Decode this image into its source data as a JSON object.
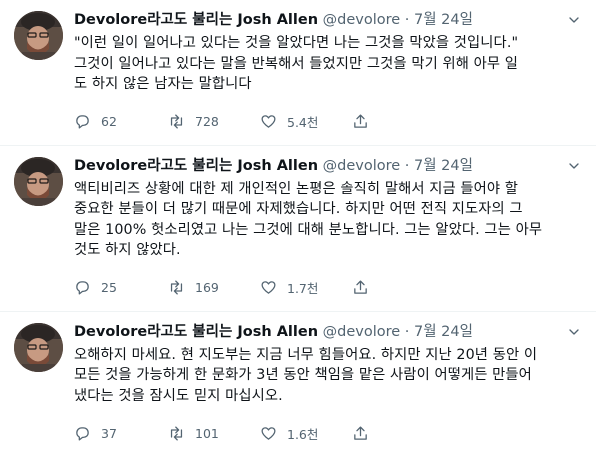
{
  "colors": {
    "text": "#0f1419",
    "secondary": "#536471",
    "divider": "#eff3f4"
  },
  "tweets": [
    {
      "display_name": "Devolore라고도 불리는 Josh Allen",
      "handle": "@devolore",
      "separator": "·",
      "date": "7월 24일",
      "text": "\"이런 일이 일어나고 있다는 것을 알았다면 나는 그것을 막았을 것입니다.\"\n그것이 일어나고 있다는 말을 반복해서 들었지만 그것을 막기 위해 아무 일\n도 하지 않은 남자는 말합니다",
      "replies": "62",
      "retweets": "728",
      "likes": "5.4천"
    },
    {
      "display_name": "Devolore라고도 불리는 Josh Allen",
      "handle": "@devolore",
      "separator": "·",
      "date": "7월 24일",
      "text": "액티비리즈 상황에 대한 제 개인적인 논평은 솔직히 말해서 지금 들어야 할\n중요한 분들이 더 많기 때문에 자제했습니다. 하지만 어떤 전직 지도자의 그\n말은 100% 헛소리였고 나는 그것에 대해 분노합니다. 그는 알았다. 그는 아무\n것도 하지 않았다.",
      "replies": "25",
      "retweets": "169",
      "likes": "1.7천"
    },
    {
      "display_name": "Devolore라고도 불리는 Josh Allen",
      "handle": "@devolore",
      "separator": "·",
      "date": "7월 24일",
      "text": "오해하지 마세요. 현 지도부는 지금 너무 힘들어요. 하지만 지난 20년 동안 이\n모든 것을 가능하게 한 문화가 3년 동안 책임을 맡은 사람이 어떻게든 만들어\n냈다는 것을 잠시도 믿지 마십시오.",
      "replies": "37",
      "retweets": "101",
      "likes": "1.6천"
    }
  ]
}
